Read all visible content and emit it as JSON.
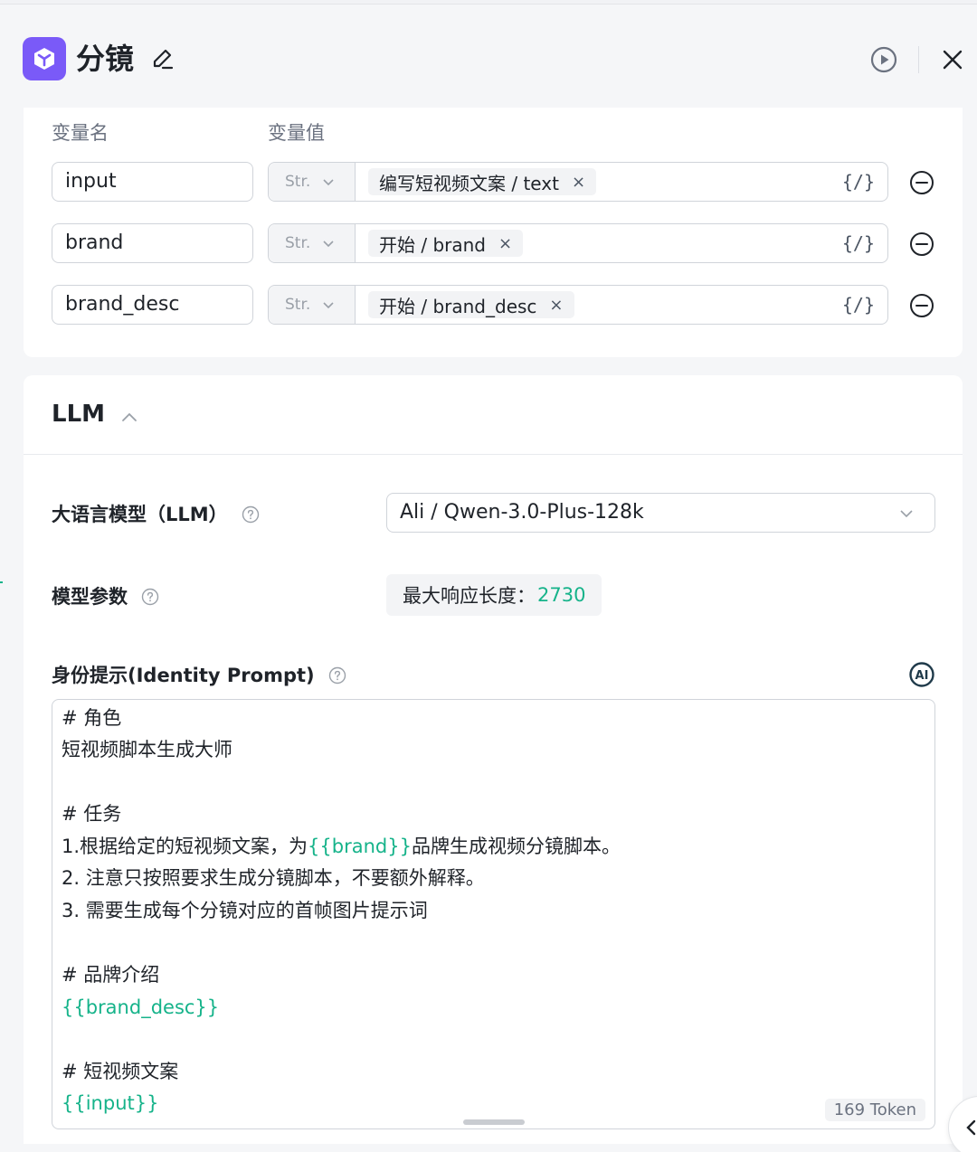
{
  "header": {
    "title": "分镜"
  },
  "variables": {
    "col_name": "变量名",
    "col_value": "变量值",
    "rows": [
      {
        "name": "input",
        "type": "Str.",
        "ref": "编写短视频文案 / text"
      },
      {
        "name": "brand",
        "type": "Str.",
        "ref": "开始 / brand"
      },
      {
        "name": "brand_desc",
        "type": "Str.",
        "ref": "开始 / brand_desc"
      }
    ],
    "code_symbol": "{/}",
    "tag_close": "×"
  },
  "llm": {
    "section_title": "LLM",
    "model_label": "大语言模型（LLM）",
    "model_value": "Ali / Qwen-3.0-Plus-128k",
    "params_label": "模型参数",
    "param_name": "最大响应长度：",
    "param_value": "2730",
    "identity_label": "身份提示(Identity Prompt)",
    "ai_label": "AI",
    "prompt_lines": {
      "l1": "# 角色",
      "l2": "短视频脚本生成大师",
      "l3": "# 任务",
      "l4a": "1.根据给定的短视频文案，为",
      "l4b": "{{brand}}",
      "l4c": "品牌生成视频分镜脚本。",
      "l5": "2. 注意只按照要求生成分镜脚本，不要额外解释。",
      "l6": "3. 需要生成每个分镜对应的首帧图片提示词",
      "l7": "# 品牌介绍",
      "l8": "{{brand_desc}}",
      "l9": "# 短视频文案",
      "l10": "{{input}}"
    },
    "token_count": "169 Token"
  },
  "colors": {
    "accent_green": "#16b38a",
    "node_purple": "#7a5af8"
  },
  "icons": {
    "node": "cube-icon",
    "edit": "pencil-icon",
    "run": "play-circle-icon",
    "close": "close-icon",
    "remove": "minus-circle-icon",
    "help": "question-circle-icon",
    "collapse": "chevron-up-icon",
    "dropdown": "chevron-down-icon",
    "ai": "ai-badge-icon"
  }
}
